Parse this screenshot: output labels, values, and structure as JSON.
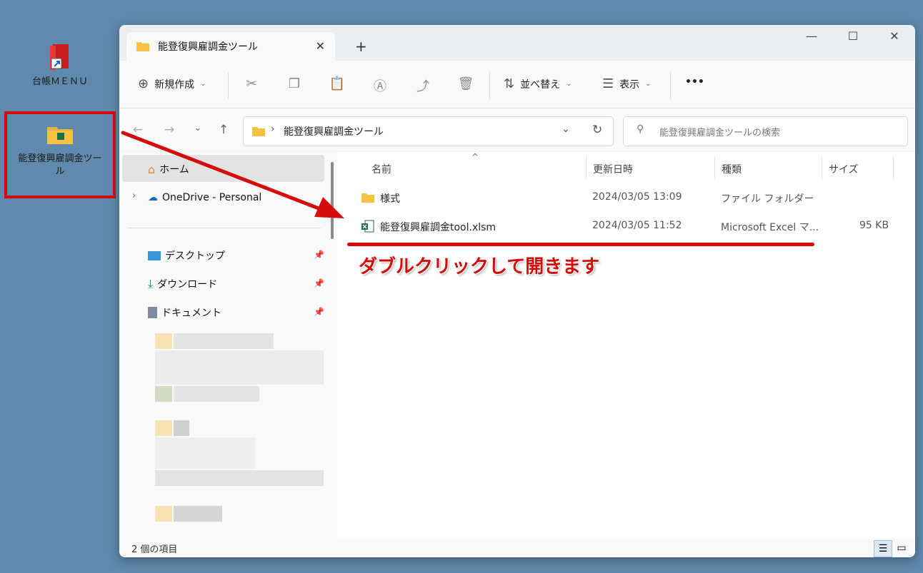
{
  "desktop": {
    "icons": [
      {
        "label": "台帳ＭＥＮＵ"
      },
      {
        "label": "能登復興雇調金ツール"
      }
    ]
  },
  "window": {
    "tab_title": "能登復興雇調金ツール",
    "new_tab": "+",
    "controls": {
      "minimize": "—",
      "maximize": "☐",
      "close": "✕"
    }
  },
  "command_bar": {
    "new_label": "新規作成",
    "sort_label": "並べ替え",
    "view_label": "表示",
    "more_label": "•••"
  },
  "address_bar": {
    "path": "能登復興雇調金ツール",
    "search_placeholder": "能登復興雇調金ツールの検索"
  },
  "sidebar": {
    "home": "ホーム",
    "onedrive": "OneDrive - Personal",
    "quick_access": [
      "デスクトップ",
      "ダウンロード",
      "ドキュメント"
    ]
  },
  "columns": {
    "name": "名前",
    "date": "更新日時",
    "type": "種類",
    "size": "サイズ"
  },
  "files": [
    {
      "name": "様式",
      "date": "2024/03/05 13:09",
      "type": "ファイル フォルダー",
      "size": ""
    },
    {
      "name": "能登復興雇調金tool.xlsm",
      "date": "2024/03/05 11:52",
      "type": "Microsoft Excel マ...",
      "size": "95 KB"
    }
  ],
  "annotation": {
    "text": "ダブルクリックして開きます",
    "color": "#d40b0b"
  },
  "status": {
    "count": "2 個の項目"
  },
  "colors": {
    "accent": "#0067c0",
    "annotation_red": "#d40b0b",
    "folder": "#f5c242",
    "excel": "#1d6f42"
  }
}
